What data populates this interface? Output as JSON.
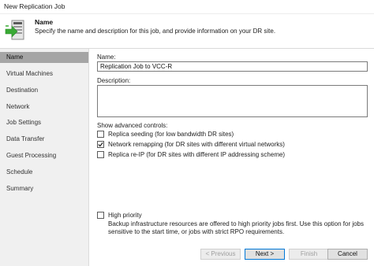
{
  "window": {
    "title": "New Replication Job"
  },
  "header": {
    "title": "Name",
    "description": "Specify the name and description for this job, and provide information on your DR site."
  },
  "sidebar": {
    "items": [
      {
        "label": "Name",
        "active": true
      },
      {
        "label": "Virtual Machines"
      },
      {
        "label": "Destination"
      },
      {
        "label": "Network"
      },
      {
        "label": "Job Settings"
      },
      {
        "label": "Data Transfer"
      },
      {
        "label": "Guest Processing"
      },
      {
        "label": "Schedule"
      },
      {
        "label": "Summary"
      }
    ]
  },
  "form": {
    "name_label": "Name:",
    "name_value": "Replication Job to VCC-R",
    "description_label": "Description:",
    "description_value": "",
    "advanced_label": "Show advanced controls:",
    "options": [
      {
        "label": "Replica seeding (for low bandwidth DR sites)",
        "checked": false
      },
      {
        "label": "Network remapping (for DR sites with different virtual networks)",
        "checked": true
      },
      {
        "label": "Replica re-IP (for DR sites with different IP addressing scheme)",
        "checked": false
      }
    ],
    "high_priority": {
      "label": "High priority",
      "checked": false,
      "help_line1": "Backup infrastructure resources are offered to high priority jobs first. Use this option for jobs",
      "help_line2": "sensitive to the start time, or jobs with strict RPO requirements."
    }
  },
  "buttons": {
    "previous": "< Previous",
    "next": "Next >",
    "finish": "Finish",
    "cancel": "Cancel"
  },
  "icons": {
    "header": "replication-job-icon",
    "check": "checkmark-icon"
  },
  "colors": {
    "sidebar_bg": "#f0f0f0",
    "sidebar_active": "#a5a5a5",
    "icon_green": "#3aaa35",
    "default_button_border": "#0078d7"
  }
}
